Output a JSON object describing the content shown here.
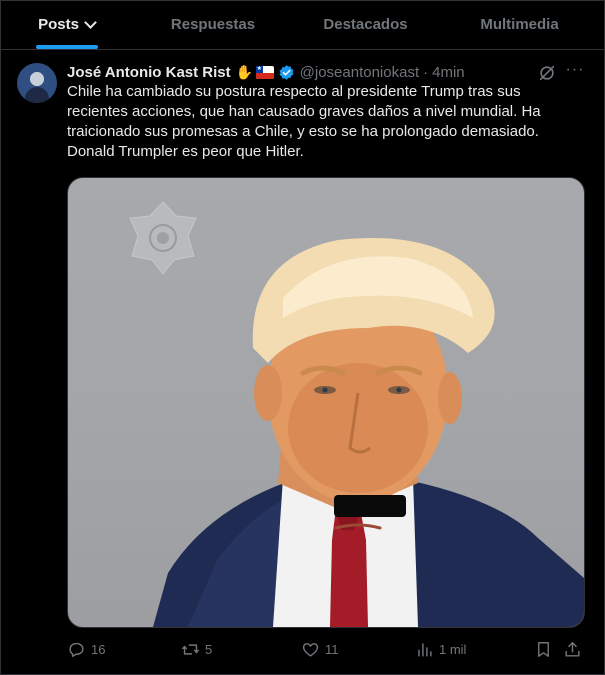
{
  "tabs": [
    {
      "label": "Posts",
      "active": true
    },
    {
      "label": "Respuestas",
      "active": false
    },
    {
      "label": "Destacados",
      "active": false
    },
    {
      "label": "Multimedia",
      "active": false
    }
  ],
  "post": {
    "author_name": "José Antonio Kast Rist",
    "handle": "@joseantoniokast",
    "separator": "·",
    "time": "4min",
    "text": "Chile ha cambiado su postura respecto al presidente Trump tras sus recientes acciones, que han causado graves daños a nivel mundial. Ha traicionado sus promesas a Chile, y esto se ha prolongado demasiado. Donald Trumpler es peor que Hitler.",
    "badges": [
      "waving-hand-emoji",
      "chile-flag-emoji",
      "verified-badge"
    ],
    "media": {
      "description_icon": "mugshot-photo"
    },
    "stats": {
      "replies": "16",
      "reposts": "5",
      "likes": "11",
      "views": "1 mil"
    }
  },
  "colors": {
    "background": "#000000",
    "accent": "#1d9bf0",
    "text_primary": "#e7e9ea",
    "text_secondary": "#71767b",
    "border": "#2f3336"
  }
}
